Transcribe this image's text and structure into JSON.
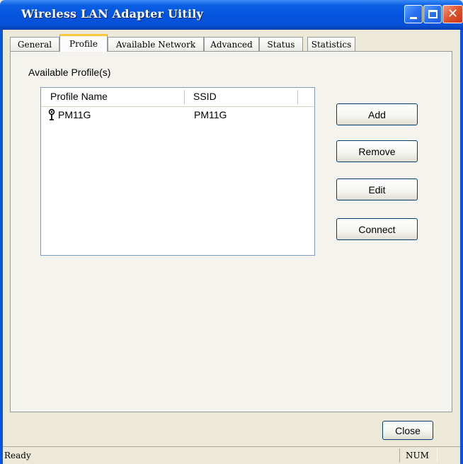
{
  "window": {
    "title": "Wireless LAN Adapter Uitily",
    "controls": {
      "minimize_icon": "minimize-icon",
      "maximize_icon": "maximize-icon",
      "close_glyph": "✕"
    }
  },
  "tabs": [
    {
      "label": "General",
      "active": false
    },
    {
      "label": "Profile",
      "active": true
    },
    {
      "label": "Available Network",
      "active": false
    },
    {
      "label": "Advanced",
      "active": false
    },
    {
      "label": "Status",
      "active": false
    },
    {
      "label": "Statistics",
      "active": false
    }
  ],
  "profile": {
    "section_label": "Available Profile(s)",
    "columns": [
      "Profile Name",
      "SSID"
    ],
    "rows": [
      {
        "icon": "wireless-signal-icon",
        "profile_name": "PM11G",
        "ssid": "PM11G"
      }
    ],
    "buttons": {
      "add": "Add",
      "remove": "Remove",
      "edit": "Edit",
      "connect": "Connect"
    }
  },
  "footer": {
    "close": "Close"
  },
  "statusbar": {
    "text": "Ready",
    "indicator": "NUM"
  },
  "colors": {
    "titlebar": "#0553dd",
    "window_bg": "#ece9d8",
    "active_tab_accent": "#ffc83c",
    "button_border": "#003c74"
  }
}
